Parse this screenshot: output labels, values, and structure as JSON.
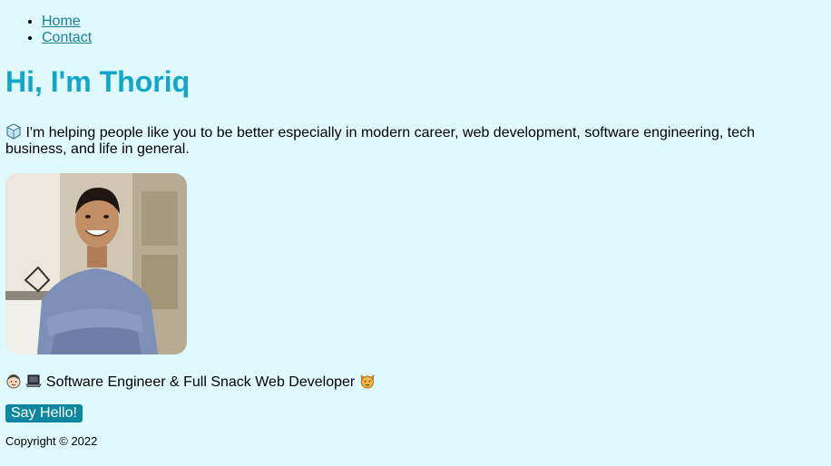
{
  "nav": {
    "items": [
      {
        "label": "Home"
      },
      {
        "label": "Contact"
      }
    ]
  },
  "hero": {
    "title": "Hi, I'm Thoriq",
    "intro_icon": "ice-cube-icon",
    "intro": "I'm helping people like you to be better especially in modern career, web development, software engineering, tech business, and life in general."
  },
  "profile": {
    "photo_icon": "person-photo"
  },
  "role": {
    "leading_icons": [
      "boy-face-icon",
      "laptop-icon"
    ],
    "text": "Software Engineer & Full Snack Web Developer",
    "trailing_icon": "cat-face-icon"
  },
  "cta": {
    "label": "Say Hello!"
  },
  "footer": {
    "copyright": "Copyright © 2022"
  },
  "colors": {
    "background": "#e0f9ff",
    "title": "#10a7c9",
    "link": "#1b7f99",
    "button": "#0c879f"
  }
}
